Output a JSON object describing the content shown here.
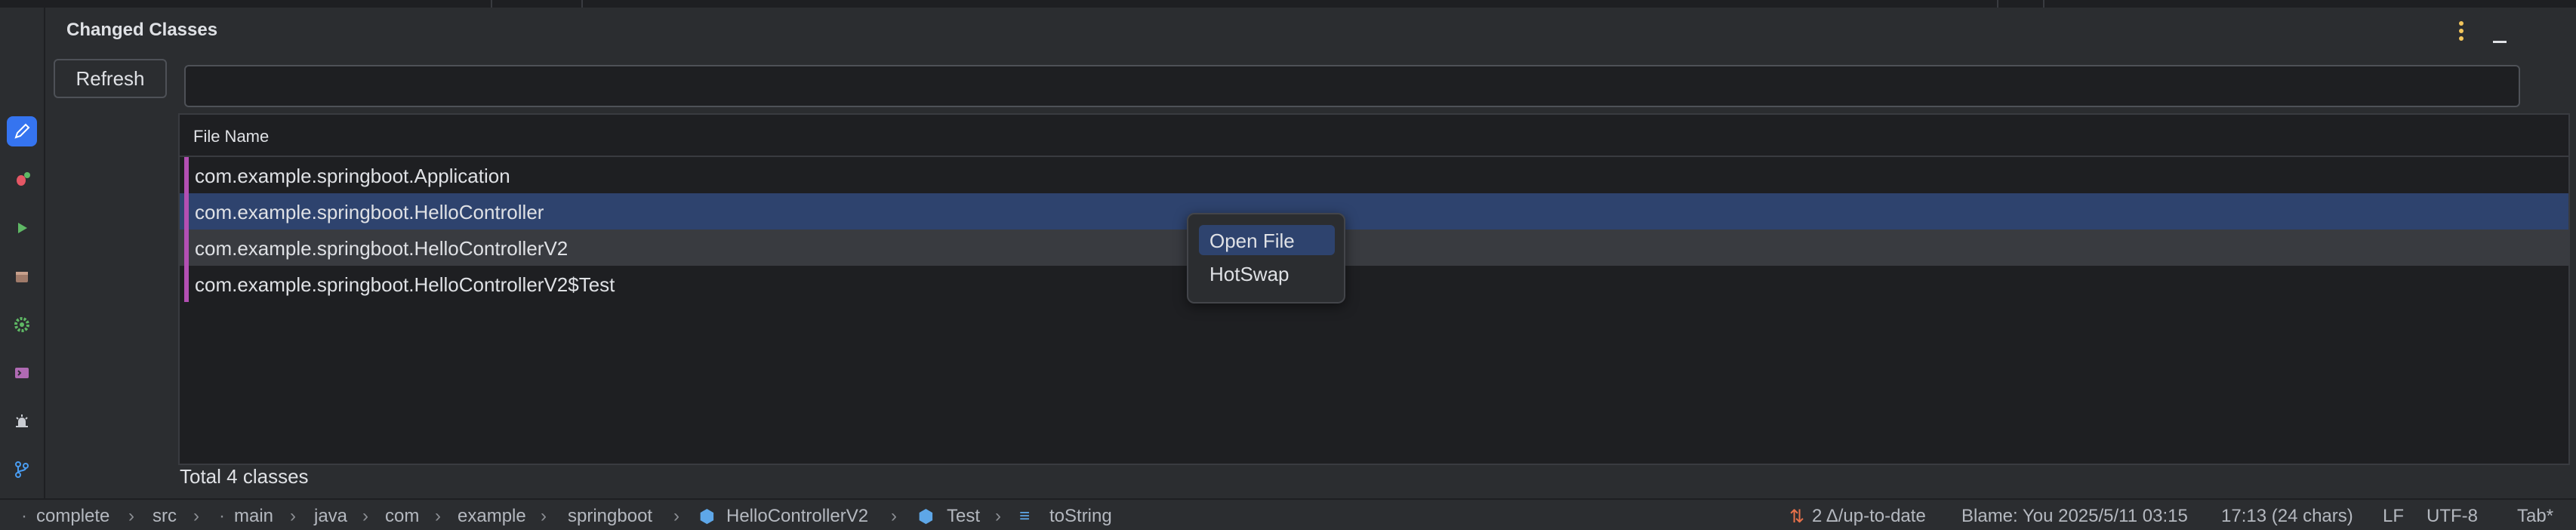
{
  "tool_window": {
    "title": "Changed Classes",
    "refresh_label": "Refresh",
    "search_value": "",
    "search_placeholder": "",
    "column_header": "File Name",
    "rows": [
      {
        "name": "com.example.springboot.Application",
        "state": "normal"
      },
      {
        "name": "com.example.springboot.HelloController",
        "state": "selected"
      },
      {
        "name": "com.example.springboot.HelloControllerV2",
        "state": "hover"
      },
      {
        "name": "com.example.springboot.HelloControllerV2$Test",
        "state": "normal"
      }
    ],
    "total_label": "Total 4 classes"
  },
  "context_menu": {
    "items": [
      {
        "label": "Open File",
        "highlighted": true
      },
      {
        "label": "HotSwap",
        "highlighted": false
      }
    ]
  },
  "left_stripe": {
    "icons": [
      "pencil-icon",
      "bug-icon",
      "run-icon",
      "package-icon",
      "settings-icon",
      "terminal-icon",
      "debug-icon",
      "git-branch-icon"
    ]
  },
  "status_bar": {
    "breadcrumbs": [
      "complete",
      "src",
      "main",
      "java",
      "com",
      "example",
      "springboot",
      "HelloControllerV2",
      "Test",
      "toString"
    ],
    "vcs": "2 Δ/up-to-date",
    "blame": "Blame: You 2025/5/11 03:15",
    "position": "17:13 (24 chars)",
    "line_sep": "LF",
    "encoding": "UTF-8",
    "indent": "Tab*"
  },
  "colors": {
    "accent": "#3574f0",
    "selection": "#2e436e",
    "changed_marker": "#b34fb3",
    "more_dots": "#f2c55c"
  }
}
